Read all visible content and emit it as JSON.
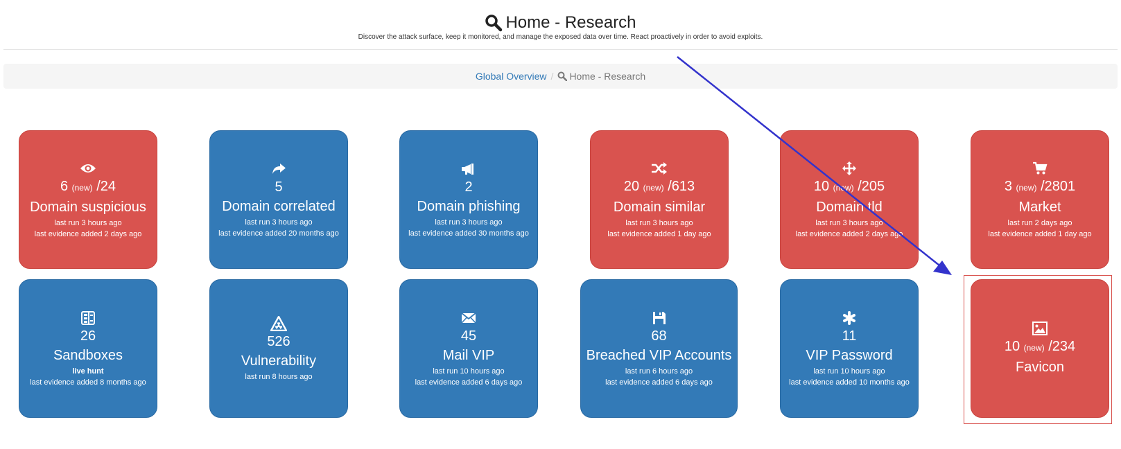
{
  "header": {
    "title": "Home - Research",
    "subtitle": "Discover the attack surface, keep it monitored, and manage the exposed data over time. React proactively in order to avoid exploits."
  },
  "breadcrumb": {
    "link": "Global Overview",
    "separator": "/",
    "current": "Home - Research"
  },
  "colors": {
    "red": "#d9534f",
    "blue": "#337ab7",
    "arrow": "#3333cc"
  },
  "tiles": [
    {
      "icon": "eye-icon",
      "count": "6",
      "new_label": "(new)",
      "total": "/24",
      "name": "Domain suspicious",
      "meta1": "last run 3 hours ago",
      "meta2": "last evidence added 2 days ago"
    },
    {
      "icon": "share-arrow-icon",
      "count": "5",
      "name": "Domain correlated",
      "meta1": "last run 3 hours ago",
      "meta2": "last evidence added 20 months ago"
    },
    {
      "icon": "megaphone-icon",
      "count": "2",
      "name": "Domain phishing",
      "meta1": "last run 3 hours ago",
      "meta2": "last evidence added 30 months ago"
    },
    {
      "icon": "shuffle-icon",
      "count": "20",
      "new_label": "(new)",
      "total": "/613",
      "name": "Domain similar",
      "meta1": "last run 3 hours ago",
      "meta2": "last evidence added 1 day ago"
    },
    {
      "icon": "move-arrows-icon",
      "count": "10",
      "new_label": "(new)",
      "total": "/205",
      "name": "Domain tld",
      "meta1": "last run 3 hours ago",
      "meta2": "last evidence added 2 days ago"
    },
    {
      "icon": "cart-icon",
      "count": "3",
      "new_label": "(new)",
      "total": "/2801",
      "name": "Market",
      "meta1": "last run 2 days ago",
      "meta2": "last evidence added 1 day ago"
    },
    {
      "icon": "sandbox-icon",
      "count": "26",
      "name": "Sandboxes",
      "meta1": "live hunt",
      "meta2": "last evidence added 8 months ago"
    },
    {
      "icon": "radiation-warning-icon",
      "count": "526",
      "name": "Vulnerability",
      "meta1": "last run 8 hours ago"
    },
    {
      "icon": "envelope-icon",
      "count": "45",
      "name": "Mail VIP",
      "meta1": "last run 10 hours ago",
      "meta2": "last evidence added 6 days ago"
    },
    {
      "icon": "floppy-disk-icon",
      "count": "68",
      "name": "Breached VIP Accounts",
      "meta1": "last run 6 hours ago",
      "meta2": "last evidence added 6 days ago"
    },
    {
      "icon": "asterisk-icon",
      "count": "11",
      "name": "VIP Password",
      "meta1": "last run 10 hours ago",
      "meta2": "last evidence added 10 months ago"
    },
    {
      "icon": "picture-icon",
      "count": "10",
      "new_label": "(new)",
      "total": "/234",
      "name": "Favicon"
    }
  ]
}
